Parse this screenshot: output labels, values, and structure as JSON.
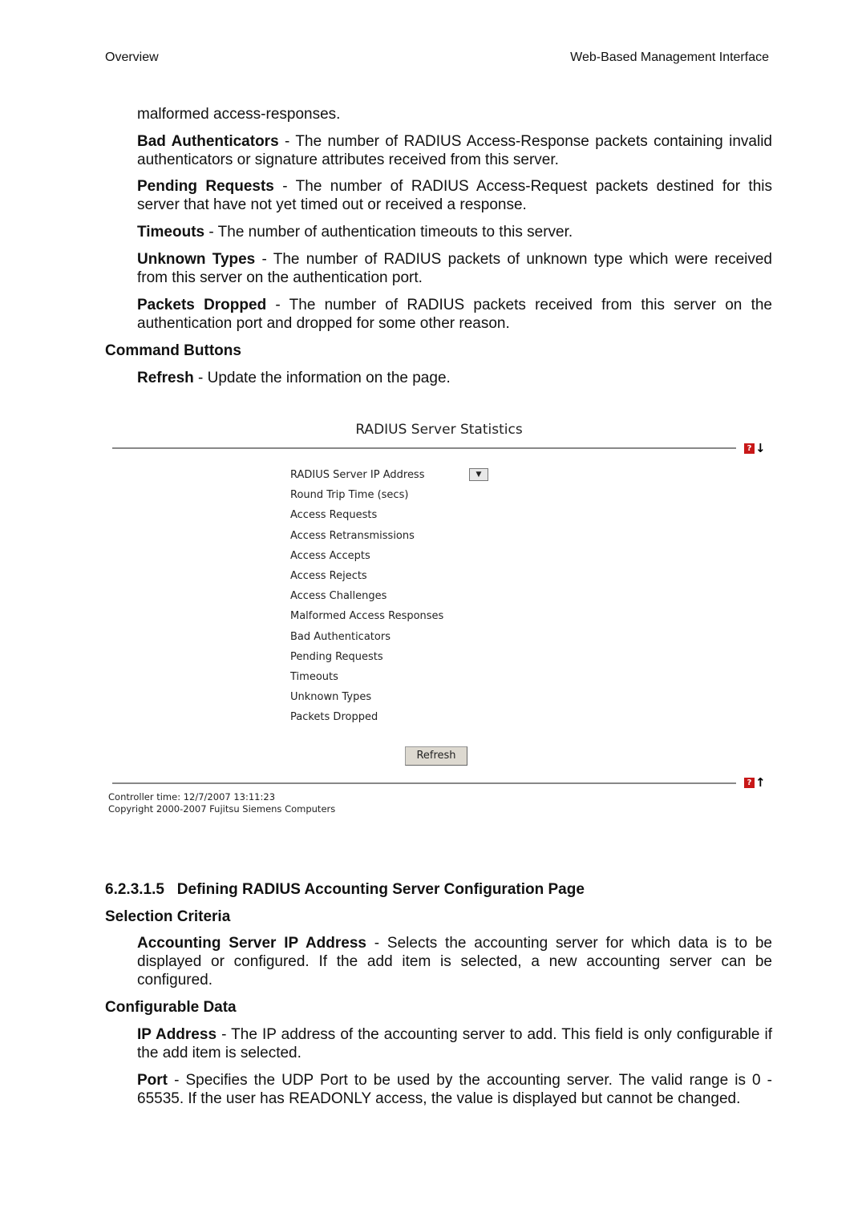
{
  "header": {
    "left": "Overview",
    "right": "Web-Based Management Interface"
  },
  "paras": [
    {
      "term": "",
      "text": "malformed access-responses."
    },
    {
      "term": "Bad Authenticators",
      "text": " - The number of RADIUS Access-Response packets containing invalid authenticators or signature attributes received from this server."
    },
    {
      "term": "Pending Requests",
      "text": " - The number of RADIUS Access-Request packets destined for this server that have not yet timed out or received a response."
    },
    {
      "term": "Timeouts",
      "text": " - The number of authentication timeouts to this server."
    },
    {
      "term": "Unknown Types",
      "text": " - The number of RADIUS packets of unknown type which were received from this server on the authentication port."
    },
    {
      "term": "Packets Dropped",
      "text": " - The number of RADIUS packets received from this server on the authentication port and dropped for some other reason."
    }
  ],
  "command_buttons": {
    "heading": "Command Buttons",
    "term": "Refresh",
    "text": " - Update the information on the page."
  },
  "screenshot": {
    "title": "RADIUS Server Statistics",
    "rows": [
      "RADIUS Server IP Address",
      "Round Trip Time (secs)",
      "Access Requests",
      "Access Retransmissions",
      "Access Accepts",
      "Access Rejects",
      "Access Challenges",
      "Malformed Access Responses",
      "Bad Authenticators",
      "Pending Requests",
      "Timeouts",
      "Unknown Types",
      "Packets Dropped"
    ],
    "refresh_label": "Refresh",
    "controller_time": "Controller time: 12/7/2007 13:11:23",
    "copyright": "Copyright 2000-2007 Fujitsu Siemens Computers",
    "help_icon": "?",
    "help_color": "#c81818"
  },
  "section": {
    "heading": "6.2.3.1.5   Defining RADIUS Accounting Server Configuration Page",
    "selection_heading": "Selection Criteria",
    "selection": {
      "term": "Accounting Server IP Address",
      "text": " - Selects the accounting server for which data is to be displayed or configured. If the add item is selected, a new accounting server can be configured."
    },
    "config_heading": "Configurable Data",
    "ip": {
      "term": "IP Address",
      "text": " - The IP address of the accounting server to add. This field is only configurable if the add item is selected."
    },
    "port": {
      "term": "Port",
      "text": " - Specifies the UDP Port to be used by the accounting server. The valid range is 0 - 65535. If the user has READONLY access, the value is displayed but cannot be changed."
    }
  }
}
